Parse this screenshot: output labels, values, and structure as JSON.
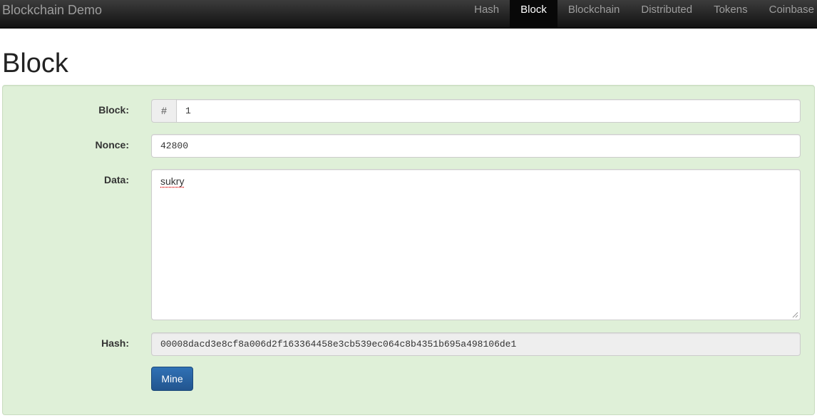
{
  "navbar": {
    "brand": "Blockchain Demo",
    "items": [
      {
        "label": "Hash",
        "active": false
      },
      {
        "label": "Block",
        "active": true
      },
      {
        "label": "Blockchain",
        "active": false
      },
      {
        "label": "Distributed",
        "active": false
      },
      {
        "label": "Tokens",
        "active": false
      },
      {
        "label": "Coinbase",
        "active": false
      }
    ]
  },
  "page": {
    "title": "Block"
  },
  "form": {
    "block_label": "Block:",
    "block_addon": "#",
    "block_value": "1",
    "nonce_label": "Nonce:",
    "nonce_value": "42800",
    "data_label": "Data:",
    "data_value": "sukry",
    "hash_label": "Hash:",
    "hash_value": "00008dacd3e8cf8a006d2f163364458e3cb539ec064c8b4351b695a498106de1",
    "mine_label": "Mine"
  },
  "colors": {
    "well_background": "#dff0d8",
    "button_primary": "#2a64a3",
    "navbar_background": "#222222"
  }
}
